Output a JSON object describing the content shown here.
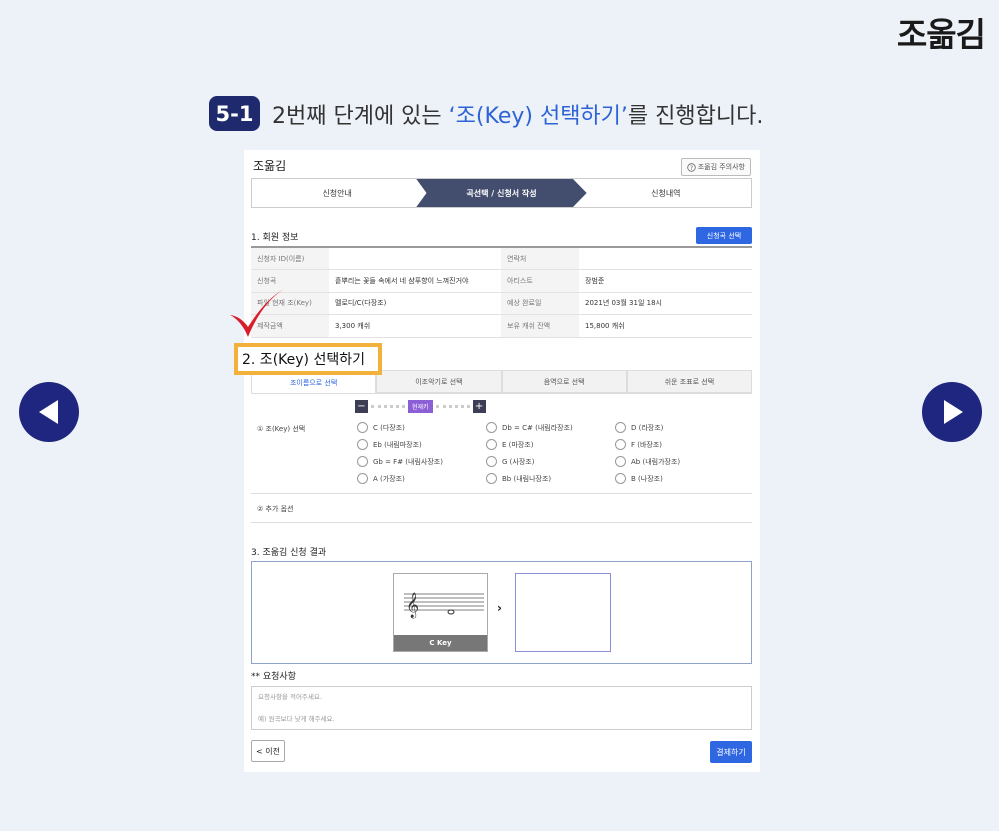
{
  "brand": "조옮김",
  "step": {
    "badge": "5-1",
    "text_before": "2번째 단계에 있는 ",
    "highlight": "‘조(Key) 선택하기’",
    "text_after": "를 진행합니다."
  },
  "nav": {
    "prev_icon": "triangle-left-icon",
    "next_icon": "triangle-right-icon"
  },
  "panel": {
    "title": "조옮김",
    "notice_label": "조옮김 주의사항",
    "steps": [
      "신청안내",
      "곡선택 / 신청서 작성",
      "신청내역"
    ],
    "active_step": 1,
    "section1_title": "1. 회원 정보",
    "select_song_button": "신청곡 선택",
    "info_rows": [
      [
        "신청자 ID(이름)",
        "",
        "연락처",
        ""
      ],
      [
        "신청곡",
        "흩뿌리는 꽃들 속에서 네 샴푸향이 느껴진거야",
        "아티스트",
        "장범준"
      ],
      [
        "파일 현재 조(Key)",
        "멜로디/C(다장조)",
        "예상 완료일",
        "2021년 03월 31일 18시"
      ],
      [
        "제작금액",
        "3,300 캐쉬",
        "보유 캐쉬 잔액",
        "15,800 캐쉬"
      ]
    ],
    "section2_title": "2. 조(Key) 선택하기",
    "key_tabs": [
      "조이름으로 선택",
      "이조악기로 선택",
      "음역으로 선택",
      "쉬운 조표로 선택"
    ],
    "active_key_tab": 0,
    "current_key_label": "현재키",
    "key_select_label": "① 조(Key) 선택",
    "key_options": [
      "C (다장조)",
      "Db = C# (내림라장조)",
      "D (라장조)",
      "Eb (내림마장조)",
      "E (마장조)",
      "F (바장조)",
      "Gb = F# (내림사장조)",
      "G (사장조)",
      "Ab (내림가장조)",
      "A (가장조)",
      "Bb (내림나장조)",
      "B (나장조)"
    ],
    "extra_option_label": "② 추가 옵션",
    "section3_title": "3. 조옮김 신청 결과",
    "result_card_caption": "C Key",
    "result_arrow": "›",
    "request_title": "** 요청사항",
    "request_placeholder_line1": "요청사항을 적어주세요.",
    "request_placeholder_line2": "예) 원곡보다 낮게 해주세요.",
    "prev_button": "< 이전",
    "pay_button": "결제하기"
  },
  "colors": {
    "accent": "#2f66e2",
    "navy": "#1f2680",
    "highlight_border": "#f2b13a",
    "check": "#d81e2a"
  }
}
